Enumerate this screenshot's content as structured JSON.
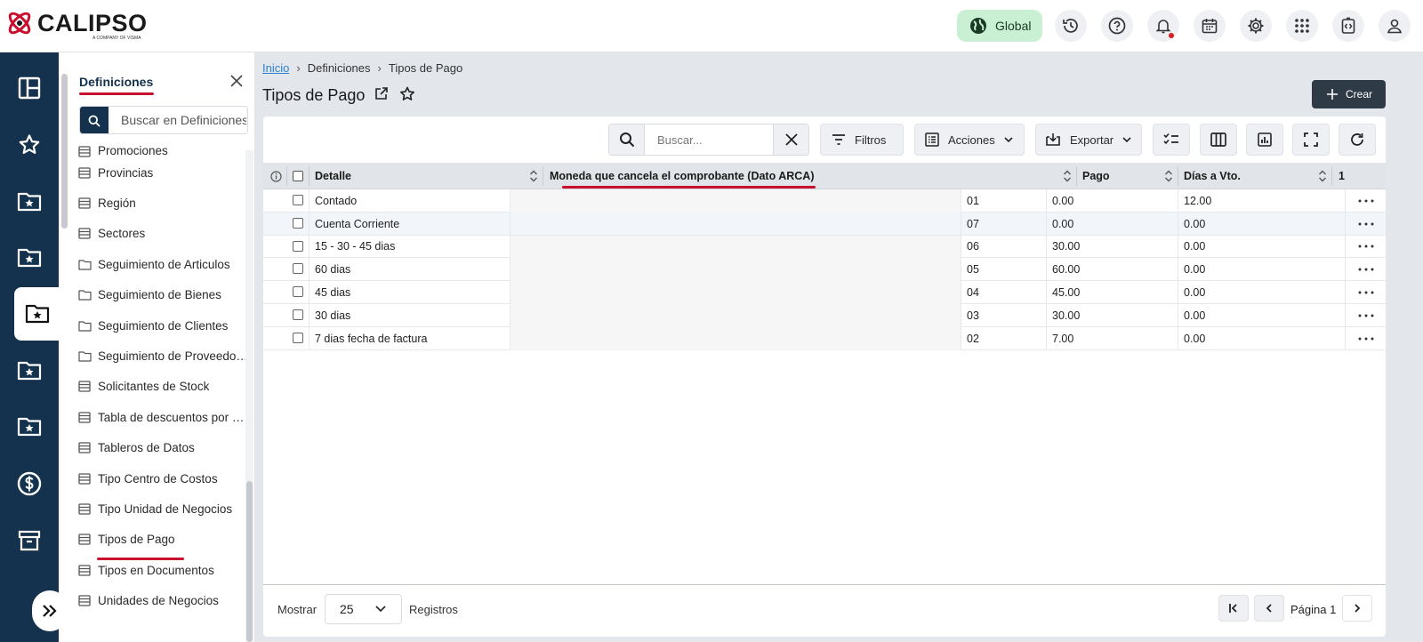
{
  "app": {
    "logo": "CALIPSO",
    "logo_tagline": "A COMPANY OF VISMA",
    "global_label": "Global"
  },
  "topbar_icons": [
    "history-icon",
    "help-icon",
    "bell-icon",
    "calendar-icon",
    "gear-icon",
    "apps-grid-icon",
    "code-icon",
    "user-icon"
  ],
  "panel": {
    "title": "Definiciones",
    "search_placeholder": "Buscar en Definiciones",
    "items": [
      {
        "label": "Promociones",
        "icon": "table-icon"
      },
      {
        "label": "Provincias",
        "icon": "table-icon"
      },
      {
        "label": "Región",
        "icon": "table-icon"
      },
      {
        "label": "Sectores",
        "icon": "table-icon"
      },
      {
        "label": "Seguimiento de Articulos",
        "icon": "folder-icon"
      },
      {
        "label": "Seguimiento de Bienes",
        "icon": "folder-icon"
      },
      {
        "label": "Seguimiento de Clientes",
        "icon": "folder-icon"
      },
      {
        "label": "Seguimiento de Proveedo…",
        "icon": "folder-icon"
      },
      {
        "label": "Solicitantes de Stock",
        "icon": "table-icon"
      },
      {
        "label": "Tabla de descuentos por …",
        "icon": "table-icon"
      },
      {
        "label": "Tableros de Datos",
        "icon": "table-icon"
      },
      {
        "label": "Tipo Centro de Costos",
        "icon": "table-icon"
      },
      {
        "label": "Tipo Unidad de Negocios",
        "icon": "table-icon"
      },
      {
        "label": "Tipos de Pago",
        "icon": "table-icon"
      },
      {
        "label": "Tipos en Documentos",
        "icon": "table-icon"
      },
      {
        "label": "Unidades de Negocios",
        "icon": "table-icon"
      }
    ]
  },
  "breadcrumb": {
    "home": "Inicio",
    "level1": "Definiciones",
    "current": "Tipos de Pago"
  },
  "page": {
    "title": "Tipos de Pago",
    "create_label": "Crear"
  },
  "toolbar": {
    "search_placeholder": "Buscar...",
    "filters": "Filtros",
    "actions": "Acciones",
    "export": "Exportar"
  },
  "table": {
    "headers": {
      "detalle": "Detalle",
      "moneda": "Moneda que cancela el comprobante (Dato ARCA)",
      "pago": "Pago",
      "dias": "Días a Vto.",
      "col5": "1"
    },
    "rows": [
      {
        "detalle": "Contado",
        "moneda": "",
        "code": "01",
        "pago": "0.00",
        "dias": "12.00"
      },
      {
        "detalle": "Cuenta Corriente",
        "moneda": "",
        "code": "07",
        "pago": "0.00",
        "dias": "0.00"
      },
      {
        "detalle": "15 - 30 - 45 dias",
        "moneda": "",
        "code": "06",
        "pago": "30.00",
        "dias": "0.00"
      },
      {
        "detalle": "60 dias",
        "moneda": "",
        "code": "05",
        "pago": "60.00",
        "dias": "0.00"
      },
      {
        "detalle": "45 dias",
        "moneda": "",
        "code": "04",
        "pago": "45.00",
        "dias": "0.00"
      },
      {
        "detalle": "30 dias",
        "moneda": "",
        "code": "03",
        "pago": "30.00",
        "dias": "0.00"
      },
      {
        "detalle": "7 dias fecha de factura",
        "moneda": "",
        "code": "02",
        "pago": "7.00",
        "dias": "0.00"
      }
    ]
  },
  "footer": {
    "show_label": "Mostrar",
    "page_size": "25",
    "records_label": "Registros",
    "page_label": "Página 1"
  },
  "colors": {
    "nav": "#14324e",
    "accent_red": "#c8102e",
    "global_bg": "#c9f0d2",
    "create_btn": "#2f3a47"
  }
}
